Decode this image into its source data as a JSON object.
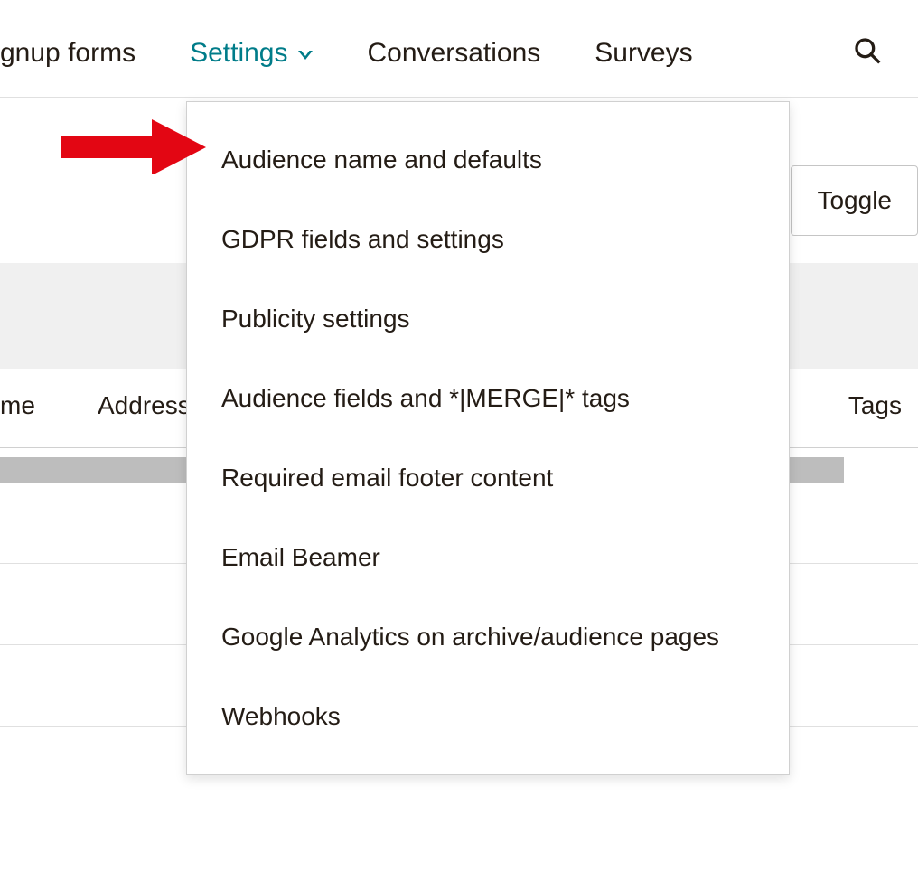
{
  "nav": {
    "signup_forms": "gnup forms",
    "settings": "Settings",
    "conversations": "Conversations",
    "surveys": "Surveys"
  },
  "dropdown": {
    "items": [
      "Audience name and defaults",
      "GDPR fields and settings",
      "Publicity settings",
      "Audience fields and *|MERGE|* tags",
      "Required email footer content",
      "Email Beamer",
      "Google Analytics on archive/audience pages",
      "Webhooks"
    ]
  },
  "toggle_label": "Toggle",
  "columns": {
    "me": "me",
    "address": "Address",
    "tags": "Tags"
  },
  "colors": {
    "active_nav": "#007c89",
    "arrow": "#e30613"
  }
}
